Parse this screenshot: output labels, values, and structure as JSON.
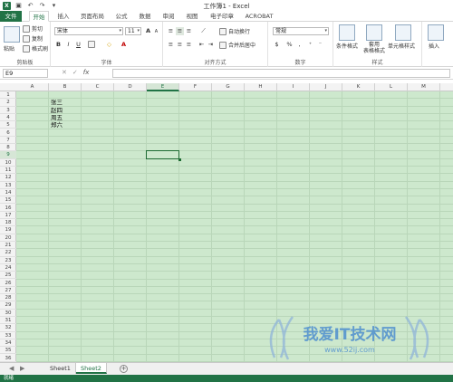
{
  "window": {
    "title": "工作簿1 - Excel"
  },
  "tabs": [
    {
      "label": "文件"
    },
    {
      "label": "开始"
    },
    {
      "label": "插入"
    },
    {
      "label": "页面布局"
    },
    {
      "label": "公式"
    },
    {
      "label": "数据"
    },
    {
      "label": "审阅"
    },
    {
      "label": "视图"
    },
    {
      "label": "电子印章"
    },
    {
      "label": "ACROBAT"
    }
  ],
  "ribbon": {
    "clipboard": {
      "paste": "粘贴",
      "cut": "剪切",
      "copy": "复制",
      "format_painter": "格式刷",
      "group_label": "剪贴板"
    },
    "font": {
      "font_name": "宋体",
      "font_size": "11",
      "bold": "B",
      "italic": "I",
      "underline": "U",
      "group_label": "字体",
      "grow": "A",
      "shrink": "A",
      "font_color": "A",
      "fill": "◇"
    },
    "alignment": {
      "wrap_text": "自动换行",
      "merge_center": "合并后居中",
      "group_label": "对齐方式"
    },
    "number": {
      "format": "常规",
      "percent": "%",
      "comma": ",",
      "group_label": "数字"
    },
    "styles": {
      "conditional": "条件格式",
      "table": "套用\n表格格式",
      "cell_styles": "单元格样式",
      "group_label": "样式"
    },
    "cells": {
      "insert": "插入"
    }
  },
  "formula_bar": {
    "name_box": "E9",
    "fx": "fx",
    "cancel": "✕",
    "enter": "✓",
    "value": ""
  },
  "grid": {
    "columns": [
      "A",
      "B",
      "C",
      "D",
      "E",
      "F",
      "G",
      "H",
      "I",
      "J",
      "K",
      "L",
      "M"
    ],
    "rows": [
      "1",
      "2",
      "3",
      "4",
      "5",
      "6",
      "7",
      "8",
      "9",
      "10",
      "11",
      "12",
      "13",
      "14",
      "15",
      "16",
      "17",
      "18",
      "19",
      "20",
      "21",
      "22",
      "23",
      "24",
      "25",
      "26",
      "27",
      "28",
      "29",
      "30",
      "31",
      "32",
      "33",
      "34",
      "35",
      "36"
    ],
    "selected_col": "E",
    "selected_row": "9",
    "cells": [
      {
        "ref": "B2",
        "value": "张三"
      },
      {
        "ref": "B3",
        "value": "赵四"
      },
      {
        "ref": "B4",
        "value": "周五"
      },
      {
        "ref": "B5",
        "value": "郑六"
      }
    ]
  },
  "sheets": {
    "tabs": [
      "Sheet1",
      "Sheet2"
    ],
    "active": "Sheet2",
    "add": "+"
  },
  "status": {
    "text": "就绪"
  },
  "watermark": {
    "text": "我爱IT技术网",
    "url": "www.52ij.com"
  },
  "colors": {
    "accent": "#217346",
    "grid_bg": "#cde8cd"
  }
}
